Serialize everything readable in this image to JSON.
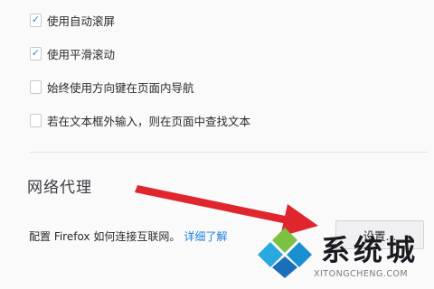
{
  "browsing_options": [
    {
      "label": "使用自动滚屏",
      "checked": true
    },
    {
      "label": "使用平滑滚动",
      "checked": true
    },
    {
      "label": "始终使用方向键在页面内导航",
      "checked": false
    },
    {
      "label": "若在文本框外输入，则在页面中查找文本",
      "checked": false
    }
  ],
  "network_proxy": {
    "title": "网络代理",
    "description": "配置 Firefox 如何连接互联网。",
    "learn_more": "详细了解",
    "settings_button": "设置..."
  },
  "annotation": {
    "arrow_color": "#e0262d",
    "icon": "red-arrow-icon"
  },
  "watermark": {
    "brand": "系统城",
    "url": "XITONGCHENG.COM",
    "icon": "xitongcheng-logo-icon",
    "colors": [
      "#2aa8e0",
      "#7cc242",
      "#1a8fd0",
      "#1b6fb8"
    ]
  }
}
